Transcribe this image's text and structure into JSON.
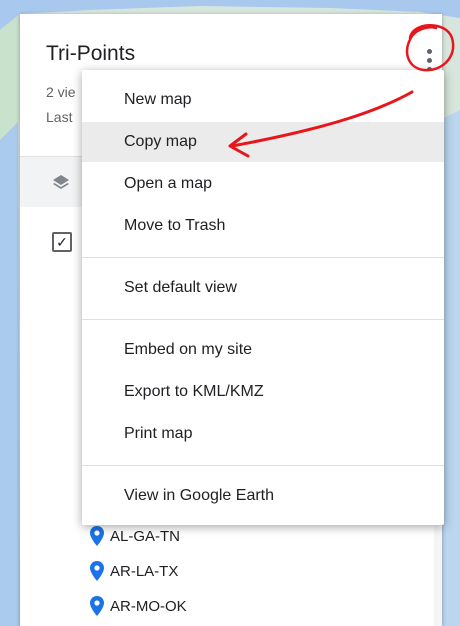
{
  "panel": {
    "title": "Tri-Points",
    "meta_line1": "2 vie",
    "meta_line2": "Last",
    "checkbox_checked": true,
    "places": [
      {
        "label": "AL-GA-TN"
      },
      {
        "label": "AR-LA-TX"
      },
      {
        "label": "AR-MO-OK"
      }
    ],
    "pin_color": "#1a73e8"
  },
  "menu": {
    "groups": [
      [
        "New map",
        "Copy map",
        "Open a map",
        "Move to Trash"
      ],
      [
        "Set default view"
      ],
      [
        "Embed on my site",
        "Export to KML/KMZ",
        "Print map"
      ],
      [
        "View in Google Earth"
      ]
    ],
    "highlighted_item": "Copy map"
  },
  "annotation_color": "#e8161b",
  "icons": {
    "more": "vertical-dots-icon",
    "layers": "layers-icon",
    "checkbox": "checkbox-icon",
    "pin": "map-pin-icon"
  }
}
